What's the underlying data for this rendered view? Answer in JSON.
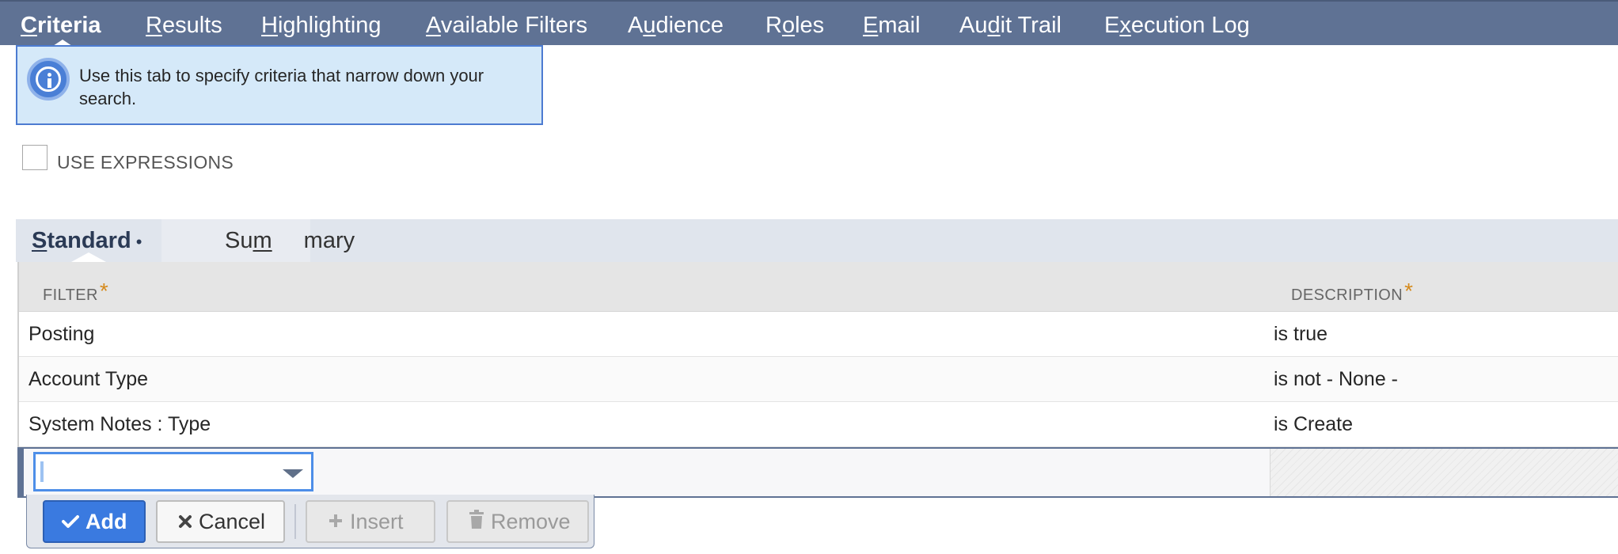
{
  "top_tabs": [
    {
      "pre": "",
      "u": "C",
      "post": "riteria",
      "active": true
    },
    {
      "pre": "",
      "u": "R",
      "post": "esults",
      "active": false
    },
    {
      "pre": "",
      "u": "H",
      "post": "ighlighting",
      "active": false
    },
    {
      "pre": "",
      "u": "A",
      "post": "vailable Filters",
      "active": false
    },
    {
      "pre": "A",
      "u": "u",
      "post": "dience",
      "active": false
    },
    {
      "pre": "R",
      "u": "o",
      "post": "les",
      "active": false
    },
    {
      "pre": "",
      "u": "E",
      "post": "mail",
      "active": false
    },
    {
      "pre": "Au",
      "u": "d",
      "post": "it Trail",
      "active": false
    },
    {
      "pre": "E",
      "u": "x",
      "post": "ecution Log",
      "active": false
    }
  ],
  "info": {
    "icon": "info-icon",
    "text": "Use this tab to specify criteria that narrow down your search."
  },
  "use_expressions": {
    "label": "USE EXPRESSIONS",
    "checked": false
  },
  "subtabs": {
    "standard": {
      "u": "S",
      "post": "tandard",
      "bullet": "•"
    },
    "summary": {
      "pre": "Su",
      "u": "m",
      "post": "mary"
    }
  },
  "table": {
    "headers": {
      "filter": "FILTER",
      "description": "DESCRIPTION",
      "required_mark": "*"
    },
    "rows": [
      {
        "filter": "Posting",
        "description": "is true"
      },
      {
        "filter": "Account Type",
        "description": "is not - None -"
      },
      {
        "filter": "System Notes : Type",
        "description": "is Create"
      }
    ],
    "edit_row": {
      "filter_value": "",
      "description_value": ""
    }
  },
  "actions": {
    "add": {
      "label": "Add",
      "icon": "check-icon"
    },
    "cancel": {
      "label": "Cancel",
      "icon": "x-icon"
    },
    "insert": {
      "label": "Insert",
      "icon": "plus-icon",
      "disabled": true
    },
    "remove": {
      "label": "Remove",
      "icon": "trash-icon",
      "disabled": true
    }
  },
  "colors": {
    "tab_bar": "#5f7294",
    "info_bg": "#d5e9f9",
    "info_border": "#4c7bd1",
    "primary_button": "#3a7ae0",
    "required_mark": "#d58a1c"
  }
}
